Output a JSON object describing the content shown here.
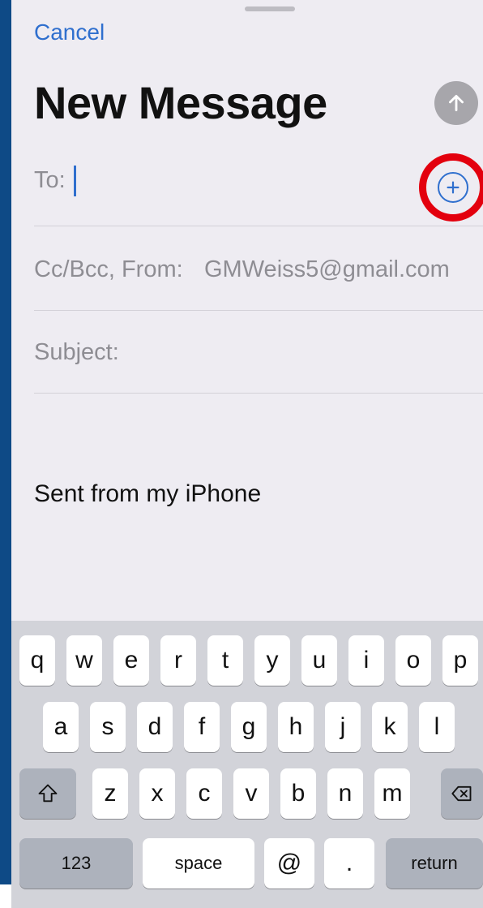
{
  "header": {
    "cancel_label": "Cancel",
    "title": "New Message",
    "send_icon": "arrow-up-icon"
  },
  "fields": {
    "to_label": "To:",
    "to_value": "",
    "cc_label": "Cc/Bcc, From:",
    "from_value": "GMWeiss5@gmail.com",
    "subject_label": "Subject:",
    "add_contact_icon": "plus-circle-icon"
  },
  "body": {
    "signature": "Sent from my iPhone"
  },
  "keyboard": {
    "row1": [
      "q",
      "w",
      "e",
      "r",
      "t",
      "y",
      "u",
      "i",
      "o",
      "p"
    ],
    "row2": [
      "a",
      "s",
      "d",
      "f",
      "g",
      "h",
      "j",
      "k",
      "l"
    ],
    "row3": [
      "z",
      "x",
      "c",
      "v",
      "b",
      "n",
      "m"
    ],
    "shift_icon": "shift-icon",
    "delete_icon": "backspace-icon",
    "numbers_label": "123",
    "space_label": "space",
    "at_label": "@",
    "dot_label": ".",
    "return_label": "return"
  },
  "colors": {
    "accent": "#2f6fce",
    "highlight_circle": "#e3000e",
    "sheet_bg": "#eeecf2",
    "keyboard_bg": "#d2d3d9"
  }
}
